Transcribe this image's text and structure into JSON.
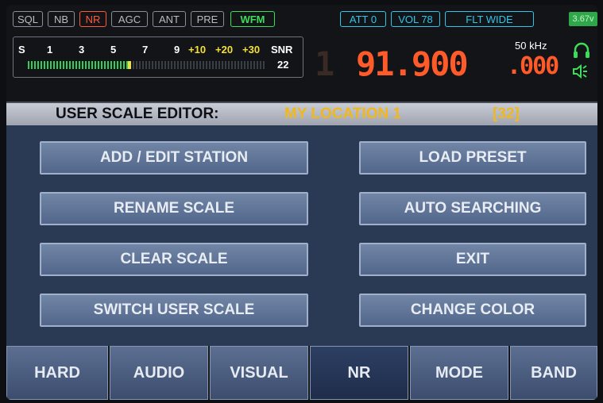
{
  "status": {
    "sql": "SQL",
    "nb": "NB",
    "nr": "NR",
    "agc": "AGC",
    "ant": "ANT",
    "pre": "PRE",
    "wfm": "WFM",
    "att": "ATT 0",
    "vol": "VOL 78",
    "flt": "FLT WIDE",
    "battery": "3.67v"
  },
  "meter": {
    "s_label": "S",
    "ticks": [
      "1",
      "3",
      "5",
      "7",
      "9"
    ],
    "plus_ticks": [
      "+10",
      "+20",
      "+30"
    ],
    "snr_label": "SNR",
    "snr_value": "22",
    "signal_level": 0.42
  },
  "frequency": {
    "ghost_digit": "1",
    "main": "91.900",
    "fraction": ".000",
    "step": "50 kHz"
  },
  "editor": {
    "label": "USER SCALE EDITOR:",
    "scale_name": "MY LOCATION 1",
    "count": "[32]"
  },
  "menu": {
    "add_edit": "ADD / EDIT  STATION",
    "rename": "RENAME  SCALE",
    "clear": "CLEAR  SCALE",
    "switch": "SWITCH USER  SCALE",
    "load_preset": "LOAD  PRESET",
    "auto_search": "AUTO SEARCHING",
    "exit": "EXIT",
    "change_color": "CHANGE COLOR"
  },
  "tabs": [
    "HARD",
    "AUDIO",
    "VISUAL",
    "NR",
    "MODE",
    "BAND"
  ],
  "active_tab": "NR",
  "colors": {
    "accent_orange": "#ff5a2a",
    "accent_cyan": "#2fc6e8",
    "accent_green": "#3ddc5a",
    "editor_name": "#f0b81e"
  }
}
